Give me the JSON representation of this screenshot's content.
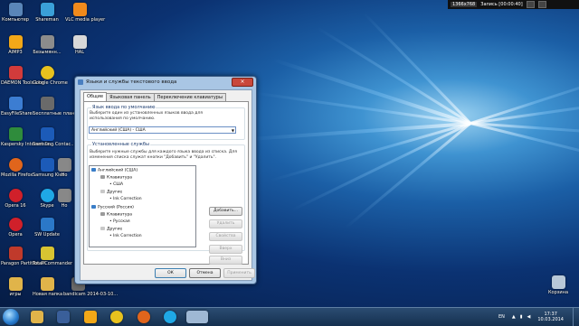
{
  "desktop_icons": [
    {
      "id": "computer",
      "label": "Компьютер",
      "color": "#5a86b8"
    },
    {
      "id": "shareman",
      "label": "Shareman",
      "color": "#3aa0d8"
    },
    {
      "id": "vlc",
      "label": "VLC media player",
      "color": "#f08a1c"
    },
    {
      "id": "aimp",
      "label": "AIMP3",
      "color": "#f2a818"
    },
    {
      "id": "untitled",
      "label": "Безымянн...",
      "color": "#8c8c8c"
    },
    {
      "id": "hal",
      "label": "HAL",
      "color": "#d8d8d8"
    },
    {
      "id": "daemon",
      "label": "DAEMON Tools Lite",
      "color": "#d23b3b"
    },
    {
      "id": "chrome",
      "label": "Google Chrome",
      "color": "#e8c21e"
    },
    {
      "id": "easyfile",
      "label": "EasyFileShare",
      "color": "#3c7dd2"
    },
    {
      "id": "freeplan",
      "label": "Бесплатные планшеты",
      "color": "#6a6a6a"
    },
    {
      "id": "kaspersky",
      "label": "Kaspersky Internet Se...",
      "color": "#2f8c3c"
    },
    {
      "id": "samsung",
      "label": "Samsung Contac...",
      "color": "#1c5bb8"
    },
    {
      "id": "mozilla",
      "label": "Mozilla Firefox",
      "color": "#e0651c"
    },
    {
      "id": "samsung2",
      "label": "Samsung Kies",
      "color": "#1c5bb8"
    },
    {
      "id": "ho1",
      "label": "Ho",
      "color": "#888888"
    },
    {
      "id": "opera16",
      "label": "Opera 16",
      "color": "#d0202a"
    },
    {
      "id": "skype",
      "label": "Skype",
      "color": "#1fa8e6"
    },
    {
      "id": "ho2",
      "label": "Ho",
      "color": "#888888"
    },
    {
      "id": "opera",
      "label": "Opera",
      "color": "#d0202a"
    },
    {
      "id": "swupdate",
      "label": "SW Update",
      "color": "#2b78c8"
    },
    {
      "id": "paragon",
      "label": "Paragon Partition M...",
      "color": "#c03a2b"
    },
    {
      "id": "totalcmd",
      "label": "Total Commander",
      "color": "#d8c432"
    },
    {
      "id": "games",
      "label": "игры",
      "color": "#e0b44a"
    },
    {
      "id": "newfolder",
      "label": "Новая папка",
      "color": "#e0b44a"
    },
    {
      "id": "bandicam",
      "label": "bandicam 2014-03-10...",
      "color": "#6a6a6a"
    },
    {
      "id": "recycle",
      "label": "Корзина",
      "color": "#b8c8d8"
    }
  ],
  "recbar": {
    "resolution": "1366x768",
    "rec_label": "Запись [00:00:40]"
  },
  "dialog": {
    "title": "Языки и службы текстового ввода",
    "close_glyph": "×",
    "tabs": [
      {
        "label": "Общие",
        "active": true
      },
      {
        "label": "Языковая панель",
        "active": false
      },
      {
        "label": "Переключение клавиатуры",
        "active": false
      }
    ],
    "default_group": {
      "title": "Язык ввода по умолчанию",
      "description": "Выберите один из установленных языков ввода для использования по умолчанию.",
      "selected": "Английский (США) - США"
    },
    "services_group": {
      "title": "Установленные службы",
      "description": "Выберите нужные службы для каждого языка ввода из списка. Для изменения списка служат кнопки \"Добавить\" и \"Удалить\".",
      "tree": [
        {
          "text": "Английский (США)",
          "level": 0,
          "icon": "lang-icon"
        },
        {
          "text": "Клавиатура",
          "level": 1,
          "icon": "keyboard-icon"
        },
        {
          "text": "США",
          "level": 2,
          "icon": "bullet"
        },
        {
          "text": "Другие",
          "level": 1,
          "icon": "other-icon"
        },
        {
          "text": "Ink Correction",
          "level": 2,
          "icon": "bullet"
        },
        {
          "text": "Русский (Россия)",
          "level": 0,
          "icon": "lang-icon"
        },
        {
          "text": "Клавиатура",
          "level": 1,
          "icon": "keyboard-icon"
        },
        {
          "text": "Русская",
          "level": 2,
          "icon": "bullet"
        },
        {
          "text": "Другие",
          "level": 1,
          "icon": "other-icon"
        },
        {
          "text": "Ink Correction",
          "level": 2,
          "icon": "bullet"
        }
      ],
      "buttons": {
        "add": "Добавить...",
        "remove": "Удалить",
        "properties": "Свойства",
        "up": "Вверх",
        "down": "Вниз"
      }
    },
    "footer": {
      "ok": "ОК",
      "cancel": "Отмена",
      "apply": "Применить"
    }
  },
  "taskbar": {
    "lang": "EN",
    "time": "17:37",
    "date": "10.03.2014"
  },
  "colors": {
    "accent": "#3c7fb1",
    "taskbar": "#15304f"
  }
}
